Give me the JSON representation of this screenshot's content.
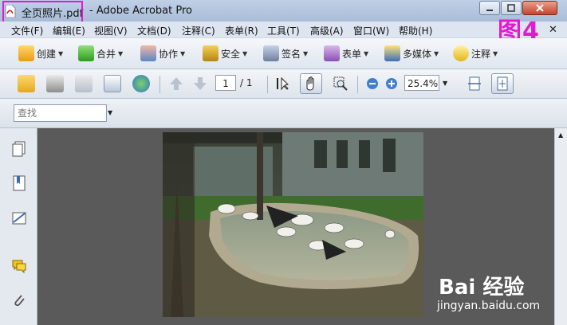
{
  "window": {
    "file_name": "全页照片.pdf",
    "separator": " - ",
    "app_name": "Adobe Acrobat Pro"
  },
  "menu": [
    "文件(F)",
    "编辑(E)",
    "视图(V)",
    "文档(D)",
    "注释(C)",
    "表单(R)",
    "工具(T)",
    "高级(A)",
    "窗口(W)",
    "帮助(H)"
  ],
  "annotation_badge": "图4",
  "tasks": {
    "create": "创建",
    "combine": "合并",
    "collaborate": "协作",
    "secure": "安全",
    "sign": "签名",
    "forms": "表单",
    "multimedia": "多媒体",
    "comment": "注释"
  },
  "navigation": {
    "current_page": "1",
    "page_total": "/ 1",
    "zoom": "25.4%"
  },
  "find": {
    "placeholder": "查找"
  },
  "watermark": {
    "brand": "Bai 经验",
    "url": "jingyan.baidu.com"
  },
  "colors": {
    "highlight": "#e21bd2",
    "viewer_bg": "#5a5a5a"
  }
}
